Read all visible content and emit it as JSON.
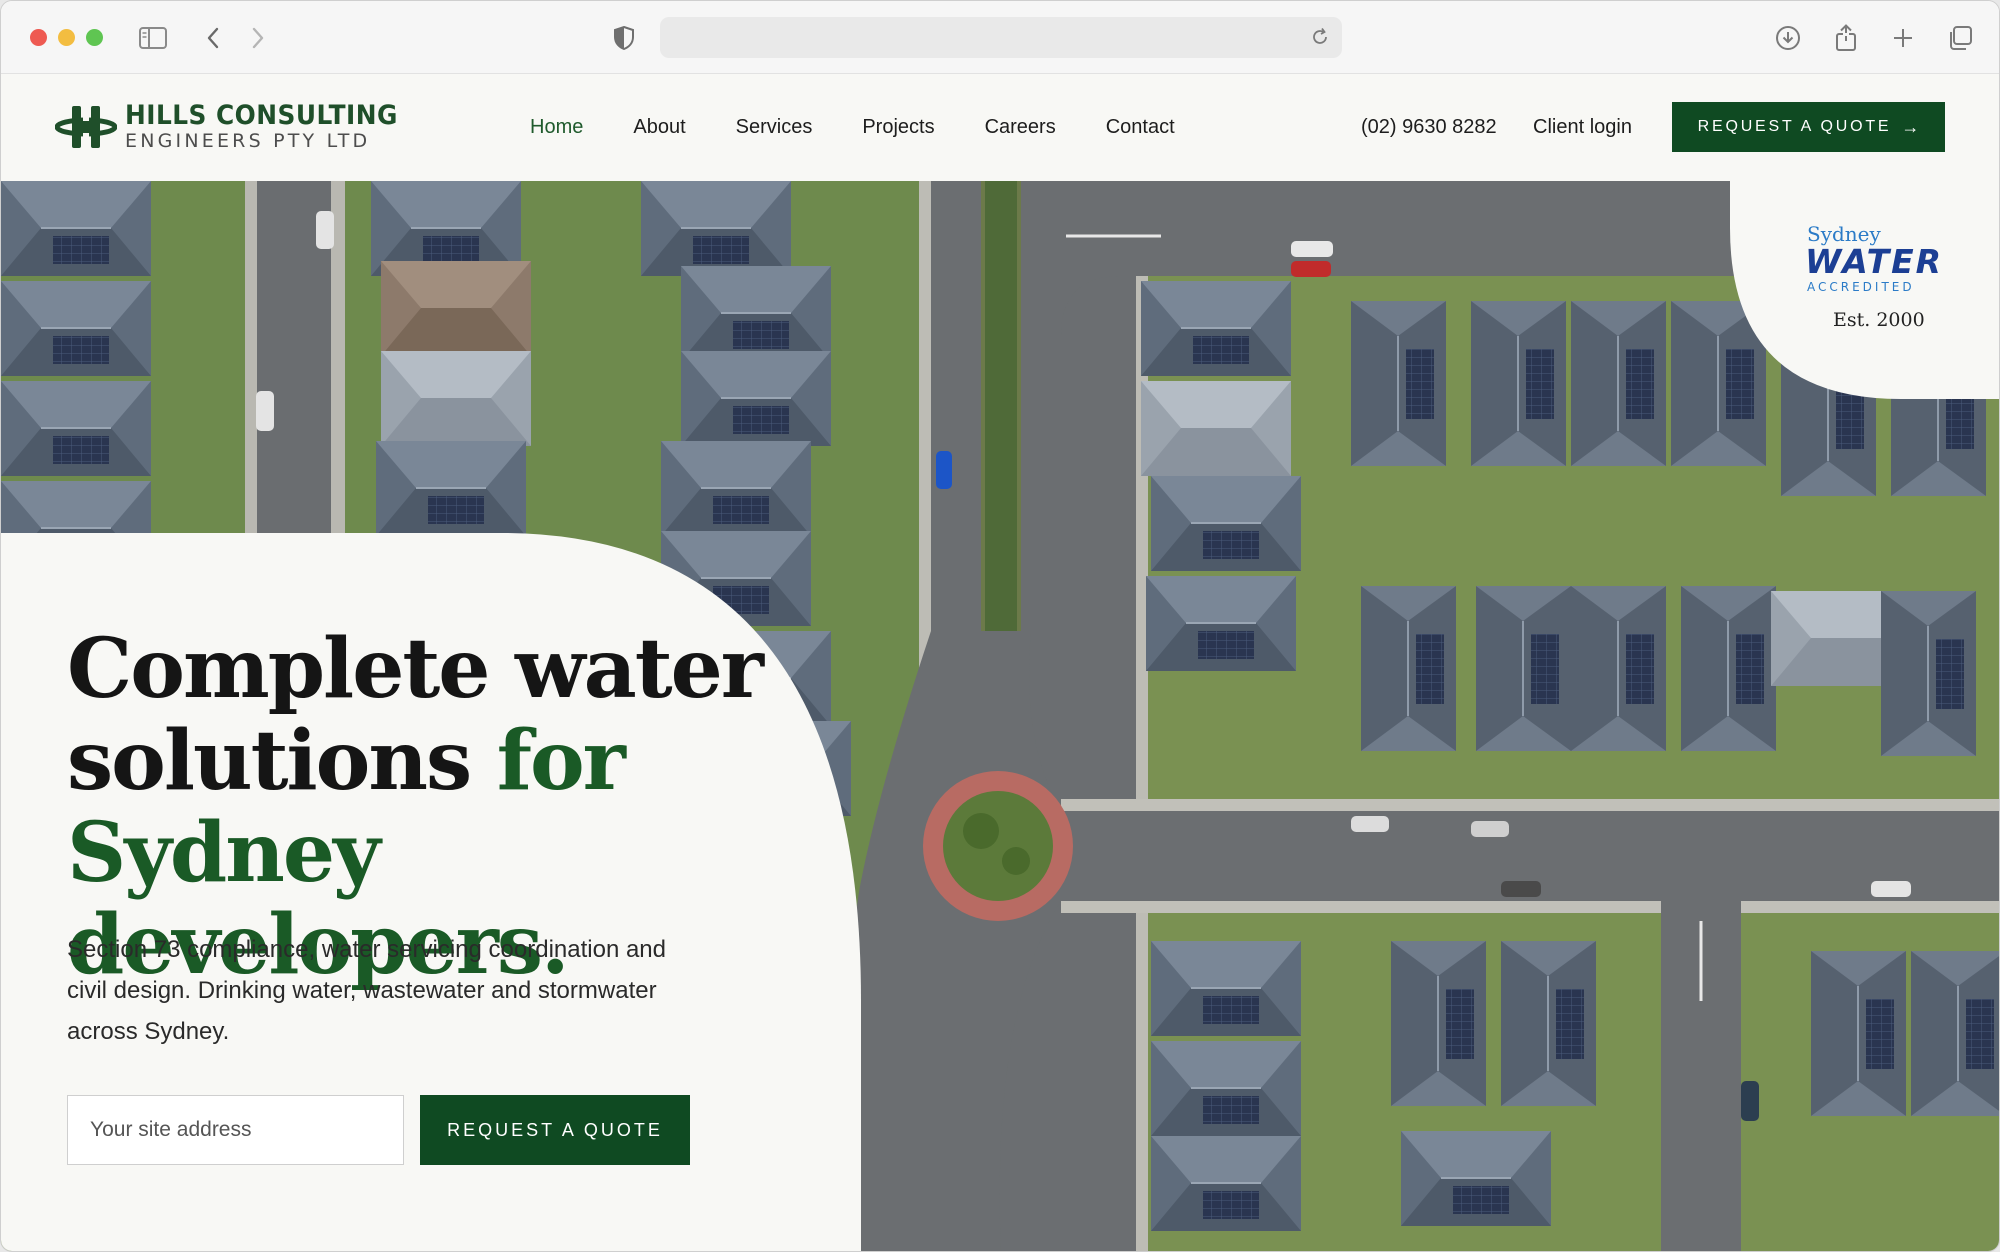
{
  "browser": {
    "url": "",
    "icons": [
      "sidebar-icon",
      "back-icon",
      "forward-icon",
      "shield-icon",
      "reload-icon",
      "download-icon",
      "share-icon",
      "new-tab-icon",
      "tabs-overview-icon"
    ]
  },
  "header": {
    "logo_line1": "HILLS CONSULTING",
    "logo_line2": "ENGINEERS PTY LTD",
    "nav": [
      {
        "label": "Home",
        "active": true
      },
      {
        "label": "About"
      },
      {
        "label": "Services"
      },
      {
        "label": "Projects"
      },
      {
        "label": "Careers"
      },
      {
        "label": "Contact"
      }
    ],
    "phone": "(02) 9630 8282",
    "client_login": "Client login",
    "cta_label": "REQUEST A QUOTE",
    "cta_arrow": "→"
  },
  "badge": {
    "line1": "Sydney",
    "line2": "WATER",
    "line3": "ACCREDITED",
    "est": "Est. 2000"
  },
  "hero": {
    "title_part1": "Complete water solutions ",
    "title_part2": "for Sydney developers.",
    "subtitle": "Section 73 compliance, water servicing coordination and civil design. Drinking water, wastewater and stormwater across Sydney.",
    "input_placeholder": "Your site address",
    "cta_label": "REQUEST A QUOTE"
  },
  "colors": {
    "brand_green": "#0f4a22",
    "accent_green": "#1a5a26",
    "page_bg": "#f8f8f5",
    "badge_blue": "#1c3f94"
  }
}
